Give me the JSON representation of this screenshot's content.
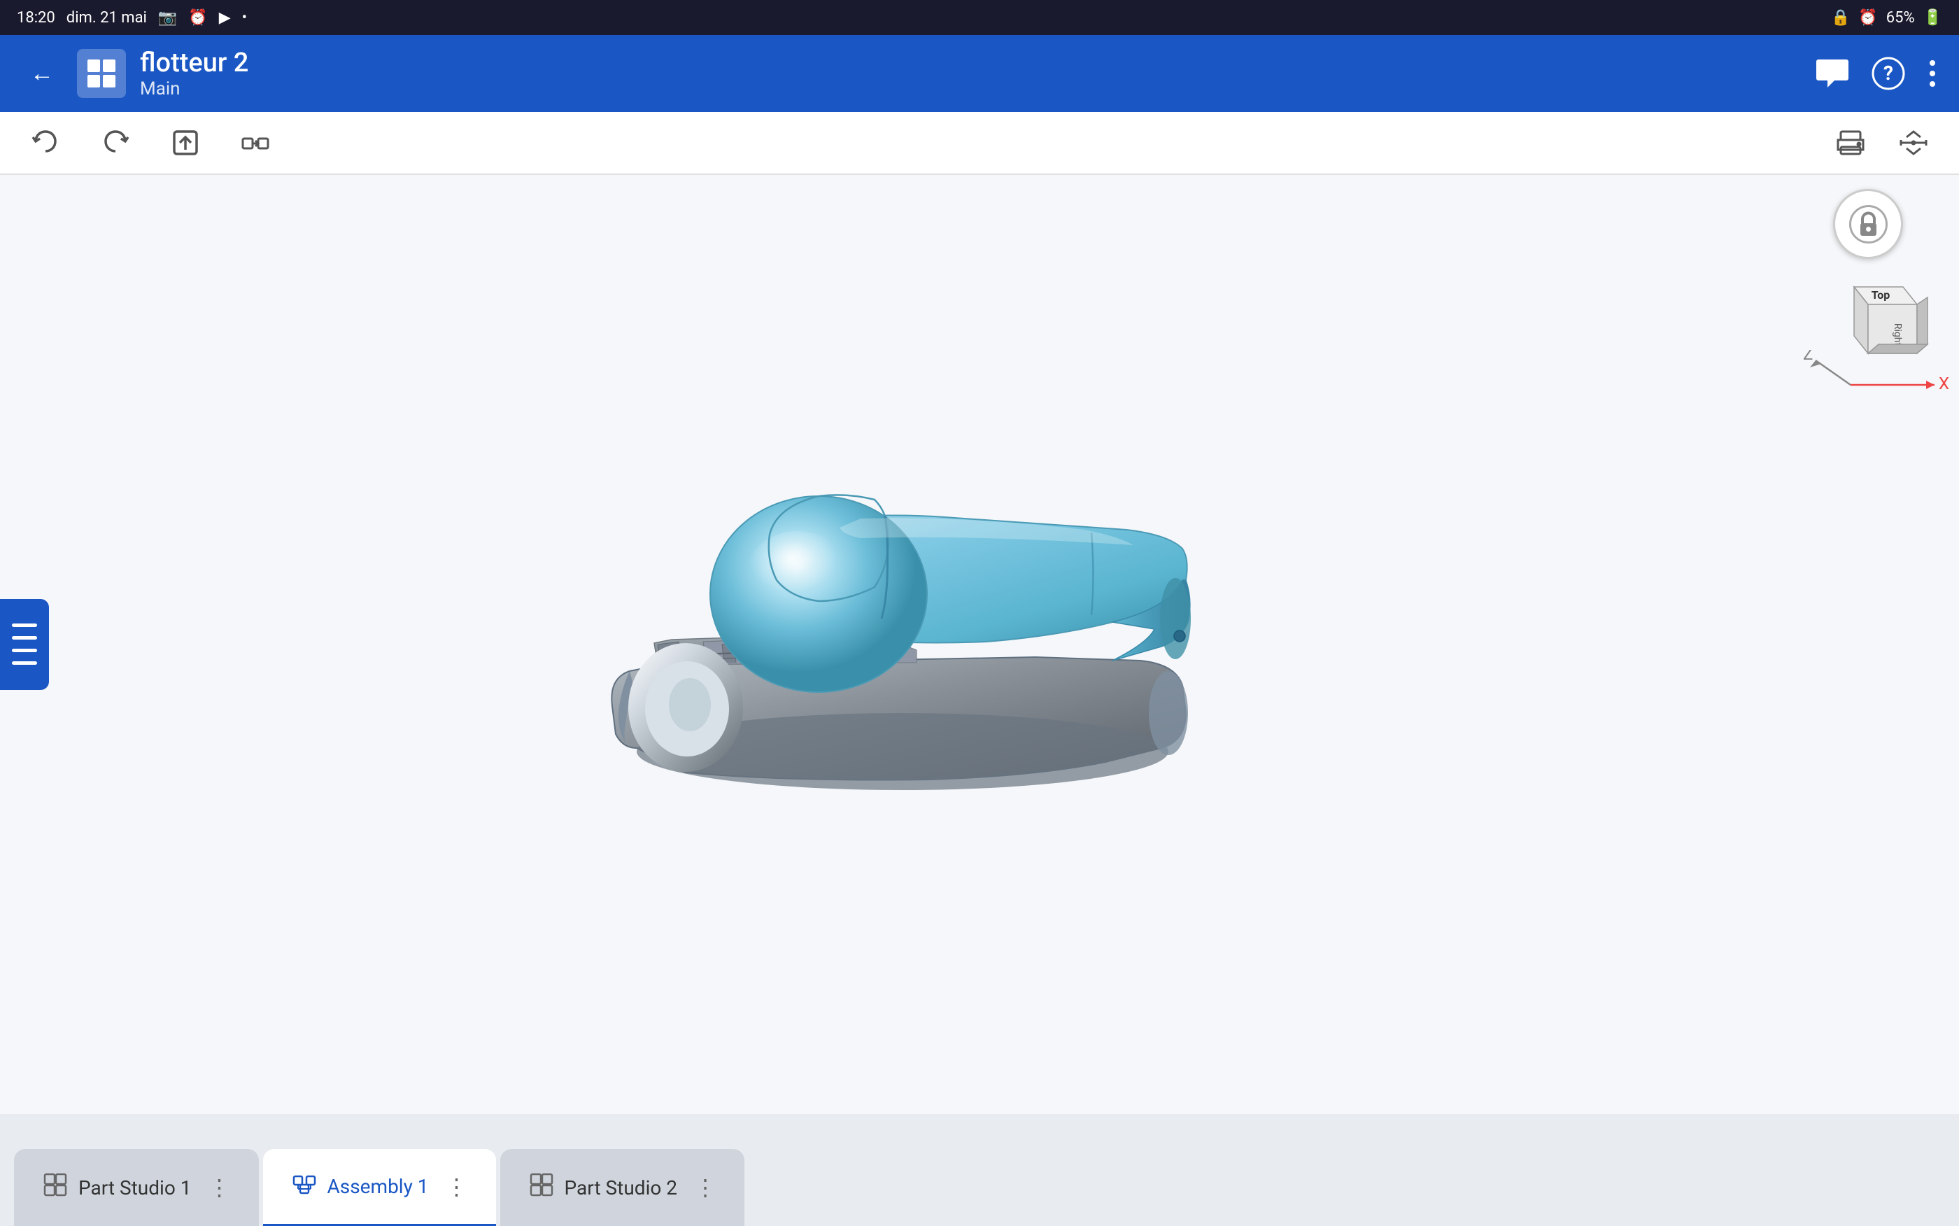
{
  "statusBar": {
    "time": "18:20",
    "date": "dim. 21 mai",
    "battery": "65%",
    "batteryIcon": "🔋"
  },
  "appBar": {
    "title": "flotteur 2",
    "subtitle": "Main",
    "backIcon": "←",
    "appIcon": "◈",
    "chatIcon": "💬",
    "helpIcon": "?",
    "menuIcon": "⋮"
  },
  "toolbar": {
    "undoLabel": "↩",
    "redoLabel": "↪",
    "exportLabel": "⬆",
    "transformLabel": "⇄",
    "printIcon": "🖨",
    "scaleIcon": "⚖"
  },
  "viewCube": {
    "topLabel": "Top",
    "rightLabel": "Right",
    "zLabel": "Z",
    "xLabel": "X",
    "lockIcon": "🔒"
  },
  "tabs": [
    {
      "id": "part-studio-1",
      "label": "Part Studio 1",
      "icon": "📄",
      "active": false
    },
    {
      "id": "assembly-1",
      "label": "Assembly 1",
      "icon": "🔧",
      "active": true
    },
    {
      "id": "part-studio-2",
      "label": "Part Studio 2",
      "icon": "📄",
      "active": false
    }
  ],
  "androidNav": {
    "menuIcon": "|||",
    "homeIcon": "○",
    "backIcon": "<"
  },
  "sidebarToggleIcon": "☰"
}
